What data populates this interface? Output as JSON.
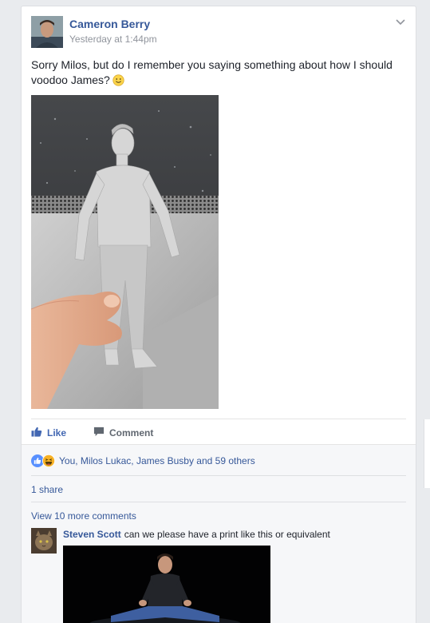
{
  "post": {
    "author": "Cameron Berry",
    "timestamp": "Yesterday at 1:44pm",
    "text": "Sorry Milos, but do I remember you saying something about how I should voodoo James?",
    "options_icon": "chevron-down-icon"
  },
  "actions": {
    "like_label": "Like",
    "comment_label": "Comment"
  },
  "reactions": {
    "summary": "You, Milos Lukac, James Busby and 59 others",
    "icons": [
      "like-reaction-icon",
      "haha-reaction-icon"
    ]
  },
  "shares": {
    "label": "1 share"
  },
  "comments": {
    "view_more": "View 10 more comments",
    "items": [
      {
        "author": "Steven Scott",
        "text": "can we please have a print like this or equivalent"
      }
    ]
  },
  "colors": {
    "link": "#365899",
    "like_active": "#4267b2",
    "background": "#e9ebee"
  }
}
